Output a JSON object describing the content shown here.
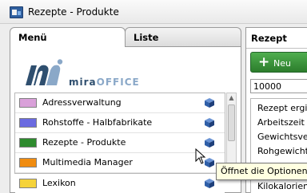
{
  "window": {
    "title": "Rezepte - Produkte"
  },
  "left_panel": {
    "tabs": [
      {
        "label": "Menü",
        "active": true
      },
      {
        "label": "Liste",
        "active": false
      }
    ],
    "logo": {
      "word_part1": "mira",
      "word_part2": "OFFICE",
      "icon": "mi-logo-icon"
    },
    "menu_items": [
      {
        "label": "Adressverwaltung",
        "color": "#d9a0d9",
        "icon": "blue-cube-icon"
      },
      {
        "label": "Rohstoffe - Halbfabrikate",
        "color": "#6a6ae0",
        "icon": "blue-cube-icon"
      },
      {
        "label": "Rezepte - Produkte",
        "color": "#2e8b2e",
        "icon": "blue-cube-icon"
      },
      {
        "label": "Multimedia Manager",
        "color": "#f08c10",
        "icon": "blue-cube-icon"
      },
      {
        "label": "Lexikon",
        "color": "#f5d33a",
        "icon": "blue-cube-icon"
      }
    ]
  },
  "right_panel": {
    "title": "Rezept",
    "new_button": {
      "label": "Neu",
      "icon": "plus-icon"
    },
    "number_field": {
      "value": "10000"
    },
    "properties": [
      "Rezept ergibt",
      "Arbeitszeit",
      "Gewichtsver",
      "Rohgewicht",
      "Kilokalorien ("
    ]
  },
  "tooltip": {
    "text": "Öffnet die Optionen,"
  },
  "colors": {
    "accent_green": "#2c7d2c",
    "tooltip_bg": "#ffffe1",
    "cube_blue": "#2f5fa8"
  }
}
